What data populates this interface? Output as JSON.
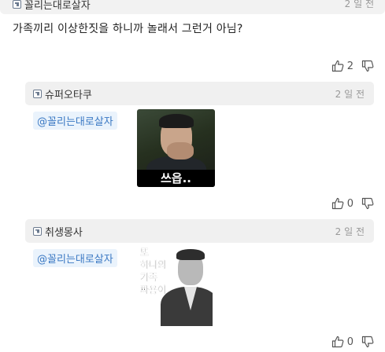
{
  "root_comment": {
    "author": "꼴리는대로살자",
    "time": "2 일 전",
    "text": "가족끼리 이상한짓을 하니까 놀래서 그런거 아님?",
    "likes": "2"
  },
  "replies": [
    {
      "author": "슈퍼오타쿠",
      "time": "2 일 전",
      "mention": "@꼴리는대로살자",
      "image_caption": "쓰읍..",
      "likes": "0"
    },
    {
      "author": "취생몽사",
      "time": "2 일 전",
      "mention": "@꼴리는대로살자",
      "image_caption_lines": [
        "또",
        "하나의",
        "가족",
        "짜용이"
      ],
      "likes": "0"
    }
  ]
}
